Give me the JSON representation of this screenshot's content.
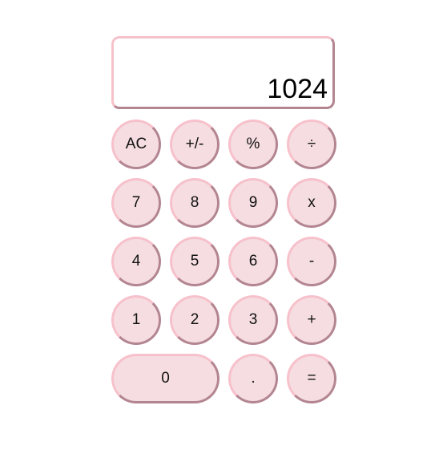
{
  "display": {
    "value": "1024"
  },
  "keys": {
    "row1": [
      "AC",
      "+/-",
      "%",
      "÷"
    ],
    "row2": [
      "7",
      "8",
      "9",
      "x"
    ],
    "row3": [
      "4",
      "5",
      "6",
      "-"
    ],
    "row4": [
      "1",
      "2",
      "3",
      "+"
    ],
    "row5": [
      "0",
      ".",
      "="
    ]
  },
  "colors": {
    "key_background": "#f5dde1",
    "border_light": "#f7c1cb",
    "border_dark": "#b38591",
    "display_background": "#ffffff"
  }
}
